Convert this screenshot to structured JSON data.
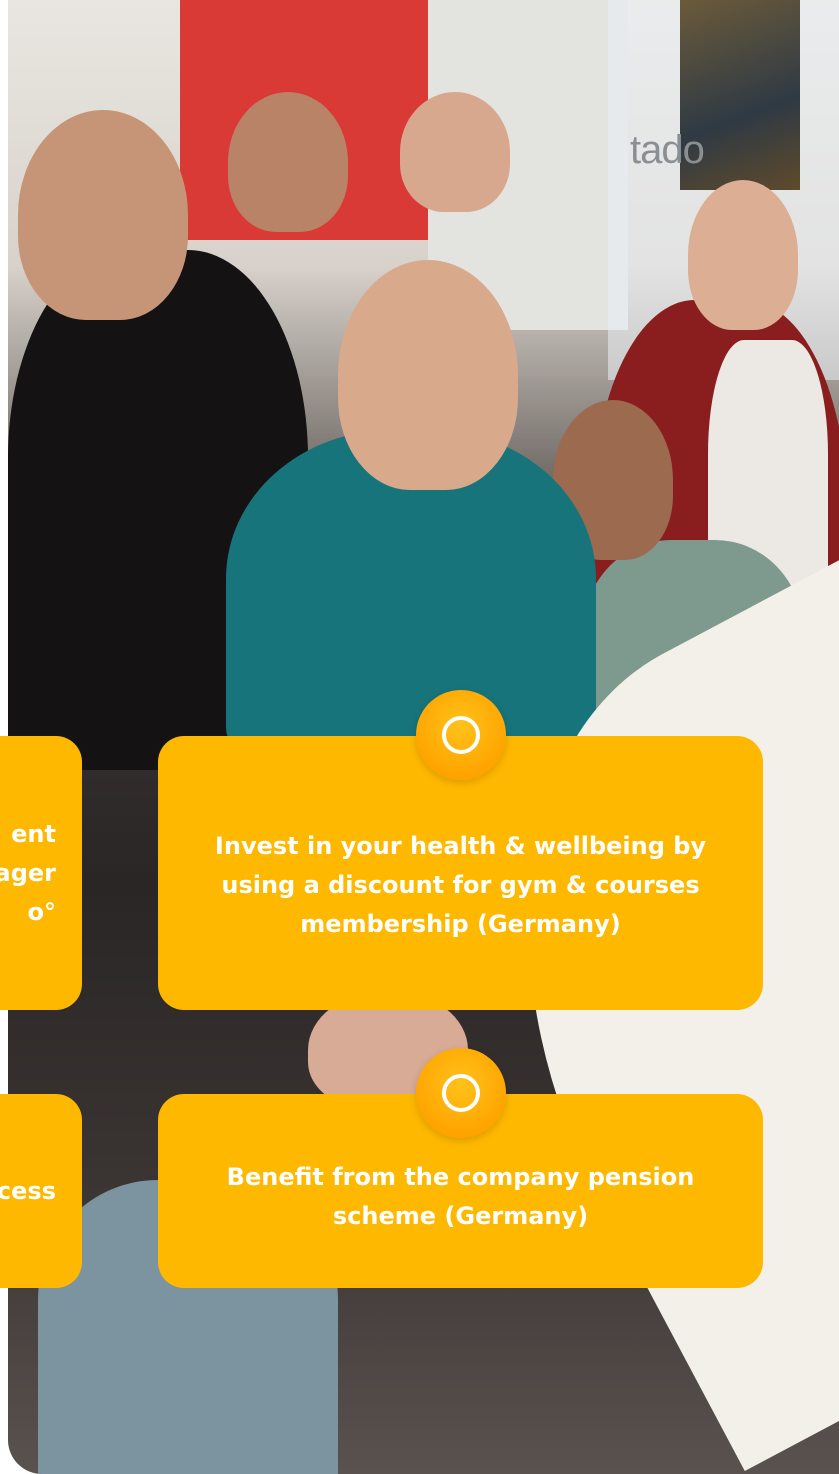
{
  "photo": {
    "wall_logo_text": "tado"
  },
  "cards": [
    {
      "text": "Invest in your health & wellbeing by using a discount for gym & courses membership (Germany)",
      "icon": "circle-icon"
    },
    {
      "text": "Benefit from the company pension scheme (Germany)",
      "icon": "circle-icon"
    }
  ],
  "partial_cards": [
    {
      "lines": [
        "ent",
        "ager",
        "o°"
      ]
    },
    {
      "lines": [
        "cess"
      ]
    }
  ],
  "colors": {
    "card": "#ffb800",
    "badge": "#ffa400",
    "text": "#ffffff"
  }
}
